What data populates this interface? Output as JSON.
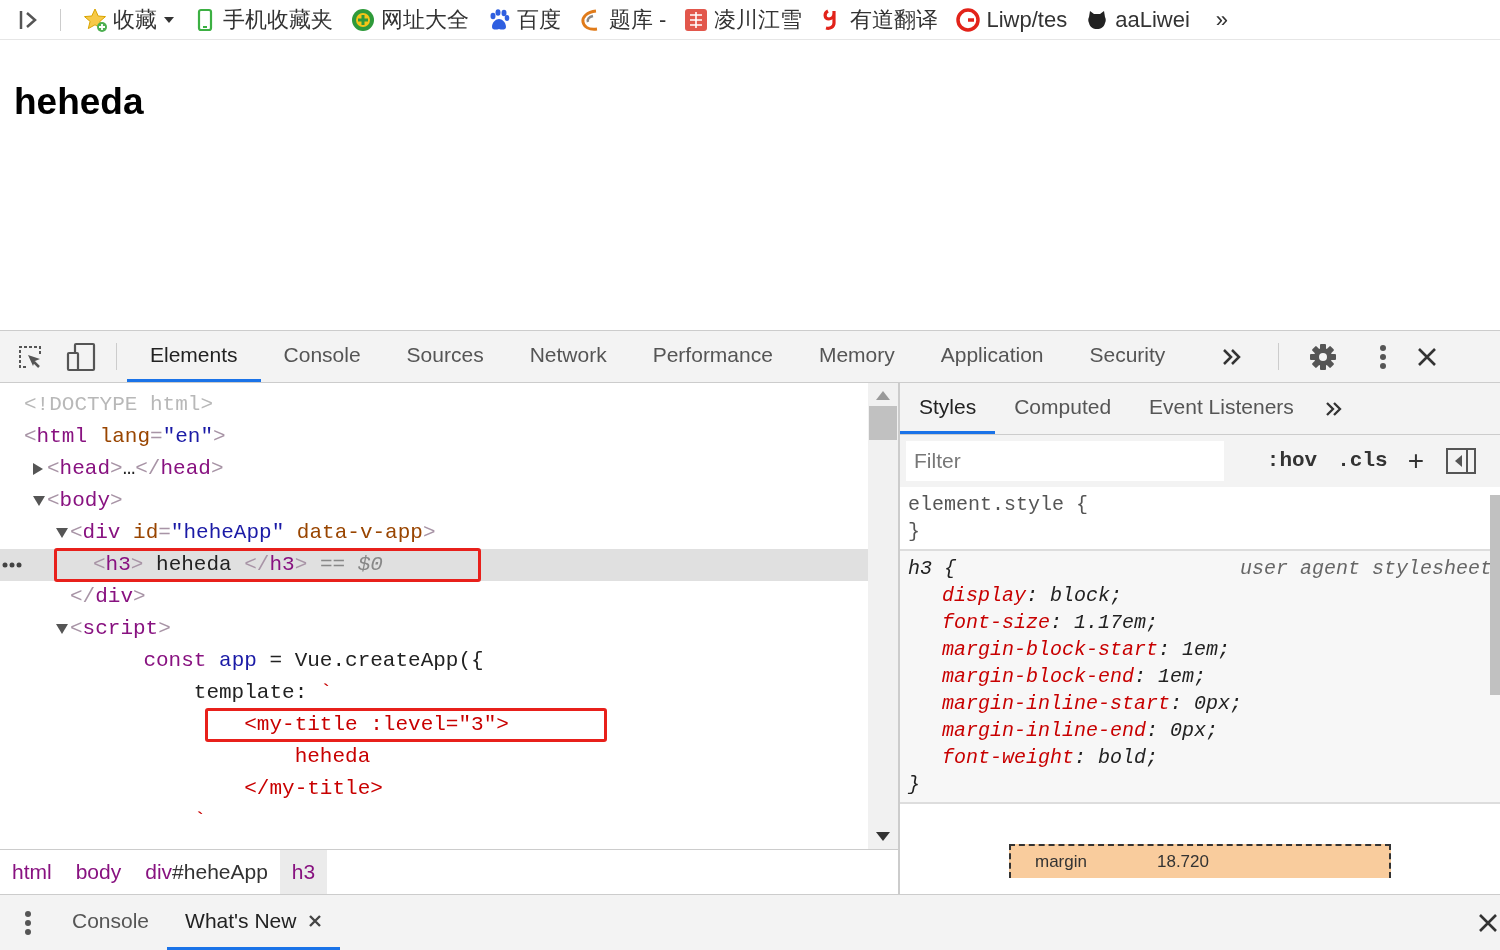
{
  "bookmarks_bar": {
    "items": [
      {
        "label": "收藏",
        "has_menu": true
      },
      {
        "label": "手机收藏夹",
        "has_menu": false
      },
      {
        "label": "网址大全",
        "has_menu": false
      },
      {
        "label": "百度",
        "has_menu": false
      },
      {
        "label": "题库 -",
        "has_menu": false
      },
      {
        "label": "凌川江雪",
        "has_menu": false
      },
      {
        "label": "有道翻译",
        "has_menu": false
      },
      {
        "label": "Liwp/tes",
        "has_menu": false
      },
      {
        "label": "aaLiwei",
        "has_menu": false
      }
    ],
    "overflow": "»"
  },
  "page": {
    "heading": "heheda"
  },
  "devtools": {
    "tabs": [
      {
        "label": "Elements",
        "selected": true
      },
      {
        "label": "Console",
        "selected": false
      },
      {
        "label": "Sources",
        "selected": false
      },
      {
        "label": "Network",
        "selected": false
      },
      {
        "label": "Performance",
        "selected": false
      },
      {
        "label": "Memory",
        "selected": false
      },
      {
        "label": "Application",
        "selected": false
      },
      {
        "label": "Security",
        "selected": false
      }
    ],
    "dom_tree": [
      {
        "tokens": [
          {
            "kind": "doctype",
            "text": "<!DOCTYPE html>"
          }
        ],
        "selected": false,
        "outlined": false
      },
      {
        "tokens": [
          {
            "kind": "punct",
            "text": "<"
          },
          {
            "kind": "tag",
            "text": "html"
          },
          {
            "kind": "attr",
            "text": " lang"
          },
          {
            "kind": "punct",
            "text": "="
          },
          {
            "kind": "value",
            "text": "\"en\""
          },
          {
            "kind": "punct",
            "text": ">"
          }
        ],
        "selected": false,
        "outlined": false,
        "children": [
          {
            "tokens": [
              {
                "kind": "punct",
                "text": "<"
              },
              {
                "kind": "tag",
                "text": "head"
              },
              {
                "kind": "punct",
                "text": ">"
              },
              {
                "kind": "text",
                "text": "…"
              },
              {
                "kind": "punct",
                "text": "</"
              },
              {
                "kind": "tag",
                "text": "head"
              },
              {
                "kind": "punct",
                "text": ">"
              }
            ],
            "expanded": false,
            "selected": false,
            "outlined": false
          },
          {
            "tokens": [
              {
                "kind": "punct",
                "text": "<"
              },
              {
                "kind": "tag",
                "text": "body"
              },
              {
                "kind": "punct",
                "text": ">"
              }
            ],
            "expanded": true,
            "selected": false,
            "outlined": false,
            "children": [
              {
                "tokens": [
                  {
                    "kind": "punct",
                    "text": "<"
                  },
                  {
                    "kind": "tag",
                    "text": "div"
                  },
                  {
                    "kind": "attr",
                    "text": " id"
                  },
                  {
                    "kind": "punct",
                    "text": "="
                  },
                  {
                    "kind": "value",
                    "text": "\"heheApp\""
                  },
                  {
                    "kind": "attr",
                    "text": " data-v-app"
                  },
                  {
                    "kind": "punct",
                    "text": ">"
                  }
                ],
                "expanded": true,
                "selected": false,
                "outlined": false,
                "closing": [
                  {
                    "kind": "punct",
                    "text": "</"
                  },
                  {
                    "kind": "tag",
                    "text": "div"
                  },
                  {
                    "kind": "punct",
                    "text": ">"
                  }
                ],
                "children": [
                  {
                    "tokens": [
                      {
                        "kind": "punct",
                        "text": "<"
                      },
                      {
                        "kind": "tag",
                        "text": "h3"
                      },
                      {
                        "kind": "punct",
                        "text": ">"
                      },
                      {
                        "kind": "text",
                        "text": " heheda "
                      },
                      {
                        "kind": "punct",
                        "text": "</"
                      },
                      {
                        "kind": "tag",
                        "text": "h3"
                      },
                      {
                        "kind": "punct",
                        "text": ">"
                      },
                      {
                        "kind": "hint",
                        "text": " == "
                      },
                      {
                        "kind": "ref",
                        "text": "$0"
                      }
                    ],
                    "selected": true,
                    "outlined": true
                  }
                ]
              },
              {
                "tokens": [
                  {
                    "kind": "punct",
                    "text": "<"
                  },
                  {
                    "kind": "tag",
                    "text": "script"
                  },
                  {
                    "kind": "punct",
                    "text": ">"
                  }
                ],
                "expanded": true,
                "selected": false,
                "outlined": false,
                "children": [
                  {
                    "tokens": [
                      {
                        "kind": "keyword",
                        "text": "    const"
                      },
                      {
                        "kind": "variable",
                        "text": " app"
                      },
                      {
                        "kind": "text",
                        "text": " = Vue.createApp({"
                      }
                    ],
                    "selected": false,
                    "outlined": false
                  },
                  {
                    "tokens": [
                      {
                        "kind": "text",
                        "text": "        template: "
                      },
                      {
                        "kind": "template",
                        "text": "`"
                      }
                    ],
                    "selected": false,
                    "outlined": false
                  },
                  {
                    "tokens": [
                      {
                        "kind": "template",
                        "text": "            <my-title :level=\"3\">"
                      }
                    ],
                    "selected": false,
                    "outlined": true
                  },
                  {
                    "tokens": [
                      {
                        "kind": "template",
                        "text": "                heheda"
                      }
                    ],
                    "selected": false,
                    "outlined": false
                  },
                  {
                    "tokens": [
                      {
                        "kind": "template",
                        "text": "            </my-title>"
                      }
                    ],
                    "selected": false,
                    "outlined": false
                  },
                  {
                    "tokens": [
                      {
                        "kind": "template",
                        "text": "        `"
                      }
                    ],
                    "selected": false,
                    "outlined": false
                  }
                ]
              }
            ]
          }
        ]
      }
    ],
    "breadcrumbs": [
      {
        "tag": "html",
        "selected": false
      },
      {
        "tag": "body",
        "selected": false
      },
      {
        "tag": "div",
        "suffix": "#heheApp",
        "selected": false
      },
      {
        "tag": "h3",
        "selected": true
      }
    ],
    "sidebar_tabs": [
      {
        "label": "Styles",
        "selected": true
      },
      {
        "label": "Computed",
        "selected": false
      },
      {
        "label": "Event Listeners",
        "selected": false
      }
    ],
    "filter": {
      "placeholder": "Filter"
    },
    "filter_buttons": [
      ":hov",
      ".cls",
      "+"
    ],
    "style_rules": [
      {
        "kind": "inline",
        "header": "element.style {",
        "close": "}"
      },
      {
        "kind": "user-agent",
        "header": "h3 {",
        "origin": "user agent stylesheet",
        "close": "}",
        "properties": [
          {
            "name": "display",
            "value": ": block;"
          },
          {
            "name": "font-size",
            "value": ": 1.17em;"
          },
          {
            "name": "margin-block-start",
            "value": ": 1em;"
          },
          {
            "name": "margin-block-end",
            "value": ": 1em;"
          },
          {
            "name": "margin-inline-start",
            "value": ": 0px;"
          },
          {
            "name": "margin-inline-end",
            "value": ": 0px;"
          },
          {
            "name": "font-weight",
            "value": ": bold;"
          }
        ]
      }
    ],
    "box_model": {
      "label": "margin",
      "value": "18.720"
    },
    "drawer_tabs": [
      {
        "label": "Console",
        "selected": false,
        "closable": false
      },
      {
        "label": "What's New",
        "selected": true,
        "closable": true
      }
    ]
  }
}
